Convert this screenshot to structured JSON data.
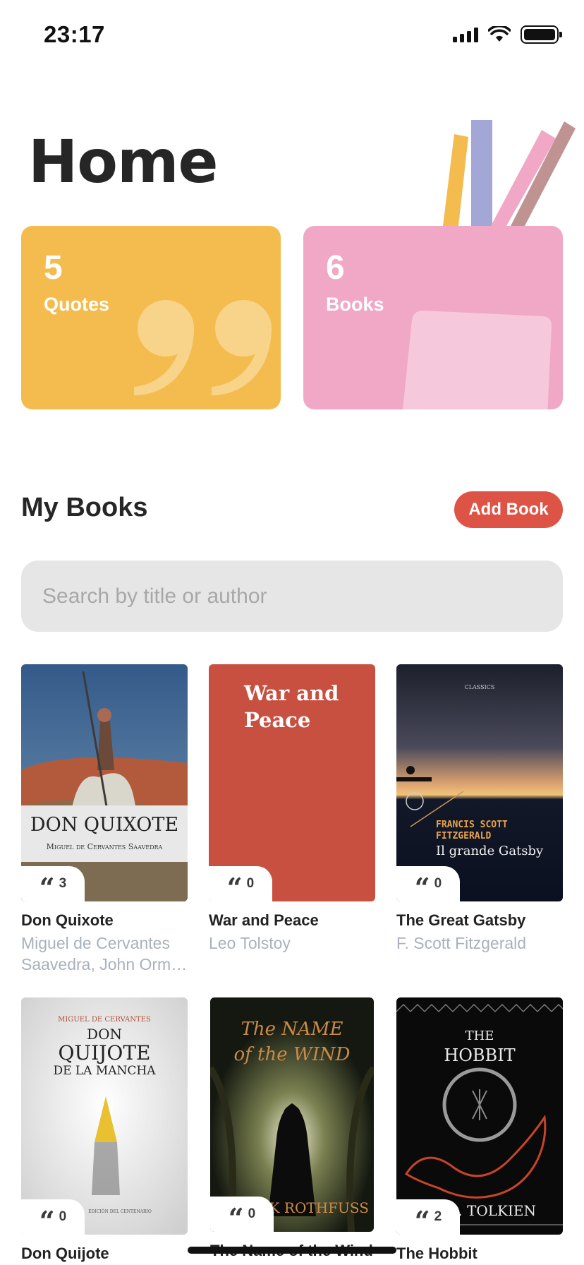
{
  "status_bar": {
    "time": "23:17"
  },
  "header": {
    "title": "Home"
  },
  "stats": {
    "quotes": {
      "count": "5",
      "label": "Quotes"
    },
    "books": {
      "count": "6",
      "label": "Books"
    }
  },
  "section": {
    "title": "My Books",
    "add_button": "Add Book"
  },
  "search": {
    "placeholder": "Search by title or author",
    "value": ""
  },
  "books": [
    {
      "title": "Don Quixote",
      "author": "Miguel de Cervantes Saavedra, John Orm…",
      "quotes": "3",
      "cover_title": "DON QUIXOTE",
      "cover_subtitle": "Miguel de Cervantes Saavedra"
    },
    {
      "title": "War and Peace",
      "author": "Leo Tolstoy",
      "quotes": "0",
      "cover_title": "War and Peace"
    },
    {
      "title": "The Great Gatsby",
      "author": "F. Scott Fitzgerald",
      "quotes": "0",
      "cover_small": "CLASSICS",
      "cover_author": "FRANCIS SCOTT FITZGERALD",
      "cover_title": "Il grande Gatsby"
    },
    {
      "title": "Don Quijote",
      "author": "",
      "quotes": "0",
      "cover_author": "MIGUEL DE CERVANTES",
      "cover_title_1": "DON",
      "cover_title_2": "QUIJOTE",
      "cover_title_3": "DE LA MANCHA",
      "cover_footer": "EDICIÓN DEL CENTENARIO"
    },
    {
      "title": "The Name of the Wind",
      "author": "",
      "quotes": "0",
      "cover_title_1": "The NAME",
      "cover_title_2": "of the WIND",
      "cover_author": "PATRICK ROTHFUSS"
    },
    {
      "title": "The Hobbit",
      "author": "",
      "quotes": "2",
      "cover_title_1": "THE",
      "cover_title_2": "HOBBIT",
      "cover_author": "J.R.R. TOLKIEN"
    }
  ],
  "colors": {
    "quotes_card": "#f4bc4f",
    "books_card": "#f0a8c6",
    "accent": "#dd5446"
  }
}
